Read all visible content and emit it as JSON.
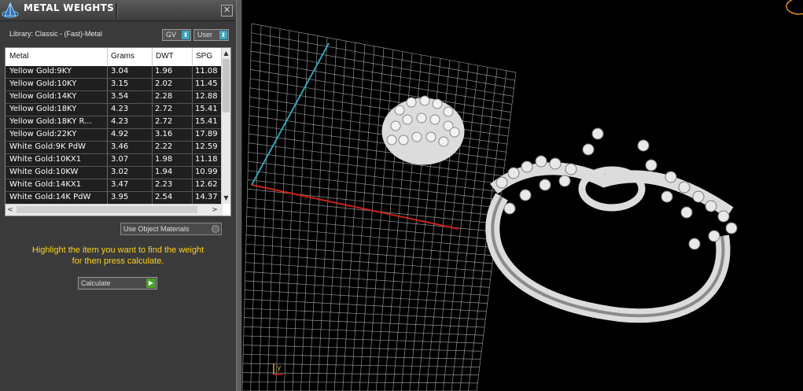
{
  "panel": {
    "title": "METAL WEIGHTS",
    "close_glyph": "✕",
    "library_label": "Library: Classic - (Fast)-Metal",
    "gv_label": "GV",
    "user_label": "User",
    "dropdown_glyph": "⬍",
    "columns": [
      "Metal",
      "Grams",
      "DWT",
      "SPG"
    ],
    "rows": [
      {
        "metal": "Yellow Gold:9KY",
        "grams": "3.04",
        "dwt": "1.96",
        "spg": "11.08"
      },
      {
        "metal": "Yellow Gold:10KY",
        "grams": "3.15",
        "dwt": "2.02",
        "spg": "11.45"
      },
      {
        "metal": "Yellow Gold:14KY",
        "grams": "3.54",
        "dwt": "2.28",
        "spg": "12.88"
      },
      {
        "metal": "Yellow Gold:18KY",
        "grams": "4.23",
        "dwt": "2.72",
        "spg": "15.41"
      },
      {
        "metal": "Yellow Gold:18KY R...",
        "grams": "4.23",
        "dwt": "2.72",
        "spg": "15.41"
      },
      {
        "metal": "Yellow Gold:22KY",
        "grams": "4.92",
        "dwt": "3.16",
        "spg": "17.89"
      },
      {
        "metal": "White Gold:9K PdW",
        "grams": "3.46",
        "dwt": "2.22",
        "spg": "12.59"
      },
      {
        "metal": "White Gold:10KX1",
        "grams": "3.07",
        "dwt": "1.98",
        "spg": "11.18"
      },
      {
        "metal": "White Gold:10KW",
        "grams": "3.02",
        "dwt": "1.94",
        "spg": "10.99"
      },
      {
        "metal": "White Gold:14KX1",
        "grams": "3.47",
        "dwt": "2.23",
        "spg": "12.62"
      },
      {
        "metal": "White Gold:14K PdW",
        "grams": "3.95",
        "dwt": "2.54",
        "spg": "14.37"
      }
    ],
    "scroll_up": "▲",
    "scroll_down": "▼",
    "scroll_left": "<",
    "scroll_right": ">",
    "use_object_materials": "Use Object Materials",
    "hint_line1": "Highlight the item you want to find the weight",
    "hint_line2": "for then press calculate.",
    "calculate_label": "Calculate",
    "calculate_glyph": "▶"
  },
  "viewport": {
    "axis_label": "y",
    "colors": {
      "grid": "#bdbdbd",
      "x_axis": "#c8231c",
      "y_axis": "#2fa6b4",
      "model": "#dcdcdc"
    }
  }
}
